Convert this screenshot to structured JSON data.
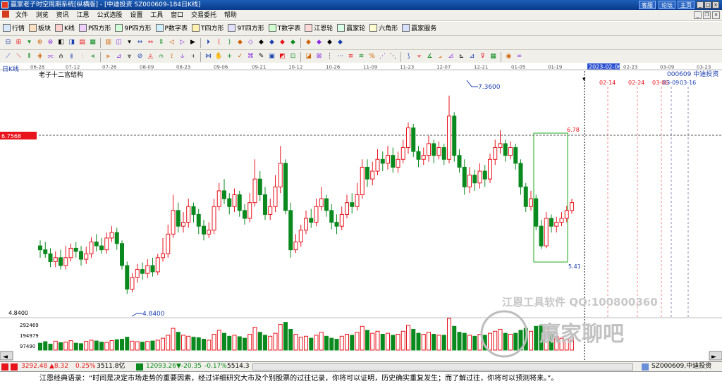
{
  "titlebar": {
    "title": "赢家老子时空周期系统[纵横版] - [中迪投资  SZ000609-184日K线]",
    "buttons": [
      "客服",
      "论坛",
      "主页"
    ],
    "brand_color": "#0a3a8c"
  },
  "menu": [
    "文件",
    "浏览",
    "资讯",
    "江恩",
    "公式选股",
    "设置",
    "工具",
    "窗口",
    "交易委托",
    "帮助"
  ],
  "toolbar1": [
    {
      "label": "行情",
      "icon": "quote-icon"
    },
    {
      "label": "板块",
      "icon": "sector-icon"
    },
    {
      "label": "K线",
      "icon": "kline-icon"
    },
    {
      "label": "P四方形",
      "icon": "p-square-icon"
    },
    {
      "label": "9P四方形",
      "icon": "9p-square-icon"
    },
    {
      "label": "P数字表",
      "icon": "p-number-icon"
    },
    {
      "label": "T四方形",
      "icon": "t-square-icon"
    },
    {
      "label": "9T四方形",
      "icon": "9t-square-icon"
    },
    {
      "label": "T数字表",
      "icon": "t-number-icon"
    },
    {
      "label": "江恩轮",
      "icon": "gann-wheel-icon"
    },
    {
      "label": "赢家轮",
      "icon": "winner-wheel-icon"
    },
    {
      "label": "六角形",
      "icon": "hexagon-icon"
    },
    {
      "label": "赢家服务",
      "icon": "service-icon"
    }
  ],
  "chart": {
    "period_label": "日K线",
    "indicator_name": "老子十二宫结构",
    "stock_label": "000609 中迪投资",
    "price_marker": "6.7568",
    "high_label": "7.3600",
    "low_label": "4.8400",
    "box_top_label": "6.78",
    "box_bottom_label": "5.41",
    "axis_low_label": "4.8400",
    "cursor_date": "2023-02-06",
    "future_dates": [
      "02-14",
      "02-24",
      "03-06",
      "03-09",
      "03-16"
    ],
    "watermark1": "江恩工具软件  QQ:100800360",
    "watermark2": "赢家聊吧",
    "volume_labels": [
      "292469",
      "194979",
      "97490"
    ],
    "up_color": "#e8141c",
    "down_color": "#0a8a1e"
  },
  "chart_data": {
    "type": "candlestick",
    "x_labels": [
      "06-28",
      "07-12",
      "07-26",
      "08-09",
      "08-23",
      "09-06",
      "09-21",
      "10-12",
      "10-26",
      "11-09",
      "11-23",
      "12-07",
      "12-21",
      "01-05",
      "01-19",
      "2023-02-06",
      "02-23",
      "03-09",
      "03-23"
    ],
    "ylim": [
      4.6,
      7.6
    ],
    "high": 7.36,
    "low": 4.84,
    "volume_ticks": [
      292469,
      194979,
      97490
    ],
    "candles": [
      [
        5.45,
        5.4,
        5.52,
        5.3
      ],
      [
        5.4,
        5.35,
        5.5,
        5.3
      ],
      [
        5.35,
        5.25,
        5.42,
        5.18
      ],
      [
        5.25,
        5.3,
        5.38,
        5.18
      ],
      [
        5.3,
        5.2,
        5.4,
        5.15
      ],
      [
        5.2,
        5.3,
        5.45,
        5.15
      ],
      [
        5.3,
        5.42,
        5.48,
        5.25
      ],
      [
        5.42,
        5.38,
        5.5,
        5.3
      ],
      [
        5.38,
        5.28,
        5.45,
        5.2
      ],
      [
        5.28,
        5.35,
        5.44,
        5.22
      ],
      [
        5.35,
        5.5,
        5.56,
        5.3
      ],
      [
        5.5,
        5.45,
        5.6,
        5.38
      ],
      [
        5.45,
        5.4,
        5.55,
        5.35
      ],
      [
        5.4,
        5.55,
        5.62,
        5.35
      ],
      [
        5.55,
        5.62,
        5.7,
        5.5
      ],
      [
        5.62,
        5.48,
        5.68,
        5.4
      ],
      [
        5.48,
        5.2,
        5.52,
        5.15
      ],
      [
        5.2,
        4.9,
        5.25,
        4.84
      ],
      [
        4.9,
        5.05,
        5.1,
        4.86
      ],
      [
        5.05,
        5.15,
        5.22,
        4.98
      ],
      [
        5.15,
        5.1,
        5.24,
        5.02
      ],
      [
        5.1,
        5.2,
        5.28,
        5.04
      ],
      [
        5.2,
        5.12,
        5.3,
        5.06
      ],
      [
        5.12,
        5.3,
        5.35,
        5.08
      ],
      [
        5.3,
        5.35,
        5.55,
        5.25
      ],
      [
        5.35,
        5.6,
        5.72,
        5.3
      ],
      [
        5.6,
        5.9,
        6.1,
        5.55
      ],
      [
        5.9,
        5.7,
        6.0,
        5.62
      ],
      [
        5.7,
        5.75,
        5.88,
        5.62
      ],
      [
        5.75,
        5.95,
        6.05,
        5.68
      ],
      [
        5.95,
        5.85,
        6.0,
        5.75
      ],
      [
        5.85,
        5.7,
        5.92,
        5.6
      ],
      [
        5.7,
        5.6,
        5.78,
        5.52
      ],
      [
        5.6,
        5.65,
        5.75,
        5.55
      ],
      [
        5.65,
        5.95,
        6.05,
        5.6
      ],
      [
        5.95,
        6.15,
        6.25,
        5.9
      ],
      [
        6.15,
        6.05,
        6.3,
        5.98
      ],
      [
        6.05,
        5.95,
        6.12,
        5.85
      ],
      [
        5.95,
        6.1,
        6.18,
        5.88
      ],
      [
        6.1,
        5.9,
        6.15,
        5.82
      ],
      [
        5.9,
        5.8,
        5.98,
        5.72
      ],
      [
        5.8,
        6.0,
        6.12,
        5.75
      ],
      [
        6.0,
        6.3,
        6.55,
        5.95
      ],
      [
        6.3,
        6.1,
        6.4,
        6.02
      ],
      [
        6.1,
        5.85,
        6.2,
        5.78
      ],
      [
        5.85,
        5.95,
        6.05,
        5.78
      ],
      [
        5.95,
        6.2,
        6.35,
        5.88
      ],
      [
        6.2,
        6.5,
        6.72,
        6.12
      ],
      [
        6.5,
        5.9,
        6.55,
        5.85
      ],
      [
        5.9,
        5.4,
        6.0,
        5.3
      ],
      [
        5.4,
        5.5,
        5.6,
        5.36
      ],
      [
        5.5,
        5.65,
        5.72,
        5.44
      ],
      [
        5.65,
        5.8,
        5.9,
        5.6
      ],
      [
        5.8,
        5.75,
        5.92,
        5.68
      ],
      [
        5.75,
        5.95,
        6.05,
        5.7
      ],
      [
        5.95,
        6.05,
        6.2,
        5.9
      ],
      [
        6.05,
        5.9,
        6.1,
        5.82
      ],
      [
        5.9,
        5.75,
        5.98,
        5.66
      ],
      [
        5.75,
        5.7,
        5.85,
        5.6
      ],
      [
        5.7,
        5.85,
        5.95,
        5.65
      ],
      [
        5.85,
        6.0,
        6.1,
        5.8
      ],
      [
        6.0,
        5.95,
        6.12,
        5.86
      ],
      [
        5.95,
        6.1,
        6.25,
        5.9
      ],
      [
        6.1,
        6.45,
        6.55,
        6.05
      ],
      [
        6.45,
        6.3,
        6.55,
        6.2
      ],
      [
        6.3,
        6.4,
        6.52,
        6.22
      ],
      [
        6.4,
        6.55,
        6.68,
        6.35
      ],
      [
        6.55,
        6.5,
        6.65,
        6.4
      ],
      [
        6.5,
        6.6,
        6.72,
        6.42
      ],
      [
        6.6,
        6.45,
        6.7,
        6.38
      ],
      [
        6.45,
        6.55,
        6.65,
        6.38
      ],
      [
        6.55,
        6.7,
        6.8,
        6.5
      ],
      [
        6.7,
        6.95,
        7.02,
        6.62
      ],
      [
        6.95,
        6.65,
        7.0,
        6.58
      ],
      [
        6.65,
        6.55,
        6.72,
        6.45
      ],
      [
        6.55,
        6.6,
        6.7,
        6.48
      ],
      [
        6.6,
        6.75,
        6.85,
        6.52
      ],
      [
        6.75,
        6.6,
        6.8,
        6.5
      ],
      [
        6.6,
        6.7,
        6.78,
        6.55
      ],
      [
        6.7,
        6.55,
        6.75,
        6.48
      ],
      [
        6.55,
        7.1,
        7.36,
        6.5
      ],
      [
        7.1,
        6.6,
        7.15,
        6.52
      ],
      [
        6.6,
        6.45,
        6.68,
        6.38
      ],
      [
        6.45,
        6.2,
        6.55,
        6.1
      ],
      [
        6.2,
        6.35,
        6.45,
        6.12
      ],
      [
        6.35,
        6.25,
        6.42,
        6.15
      ],
      [
        6.25,
        6.4,
        6.5,
        6.18
      ],
      [
        6.4,
        6.3,
        6.48,
        6.2
      ],
      [
        6.3,
        6.55,
        6.62,
        6.25
      ],
      [
        6.55,
        6.7,
        6.8,
        6.48
      ],
      [
        6.7,
        6.75,
        6.92,
        6.62
      ],
      [
        6.75,
        6.6,
        6.8,
        6.52
      ],
      [
        6.6,
        6.7,
        6.78,
        6.55
      ],
      [
        6.7,
        6.5,
        6.75,
        6.42
      ],
      [
        6.5,
        6.2,
        6.55,
        6.1
      ],
      [
        6.2,
        5.95,
        6.25,
        5.88
      ],
      [
        5.95,
        6.05,
        6.15,
        5.9
      ],
      [
        6.05,
        5.7,
        6.1,
        5.65
      ],
      [
        5.7,
        5.45,
        5.78,
        5.41
      ],
      [
        5.45,
        5.8,
        5.88,
        5.42
      ],
      [
        5.8,
        5.7,
        5.85,
        5.62
      ],
      [
        5.7,
        5.75,
        5.82,
        5.62
      ],
      [
        5.75,
        5.8,
        5.88,
        5.7
      ],
      [
        5.8,
        5.9,
        5.96,
        5.75
      ],
      [
        5.9,
        6.0,
        6.05,
        5.86
      ]
    ],
    "volumes": [
      70,
      85,
      60,
      90,
      75,
      80,
      95,
      70,
      65,
      88,
      100,
      92,
      80,
      78,
      96,
      105,
      110,
      130,
      90,
      85,
      80,
      88,
      92,
      100,
      120,
      150,
      220,
      180,
      150,
      140,
      130,
      125,
      110,
      100,
      160,
      200,
      170,
      140,
      150,
      135,
      120,
      160,
      230,
      180,
      150,
      140,
      170,
      260,
      280,
      210,
      160,
      130,
      140,
      120,
      150,
      180,
      140,
      120,
      110,
      140,
      160,
      150,
      180,
      240,
      200,
      170,
      190,
      160,
      170,
      150,
      160,
      190,
      250,
      210,
      170,
      160,
      180,
      160,
      150,
      150,
      320,
      240,
      180,
      170,
      150,
      140,
      160,
      150,
      170,
      190,
      210,
      170,
      160,
      170,
      200,
      220,
      190,
      240,
      250,
      230,
      160,
      140,
      120,
      110,
      130
    ]
  },
  "status": {
    "sh_index": "3292.48",
    "sh_change": "▲8.32",
    "sh_pct": "0.25%",
    "sh_amount": "3511.8亿",
    "sz_index": "12093.26",
    "sz_change": "▼-20.35",
    "sz_pct": "-0.17%",
    "sz_amount": "5514.3",
    "right_stock": "SZ000609,中迪投资"
  },
  "quote": "江恩经典语录：“时间是决定市场走势的重要因素，经过详细研究大市及个别股票的过往记录，你将可以证明，历史确实重复发生；而了解过往，你将可以预测将来。”。"
}
